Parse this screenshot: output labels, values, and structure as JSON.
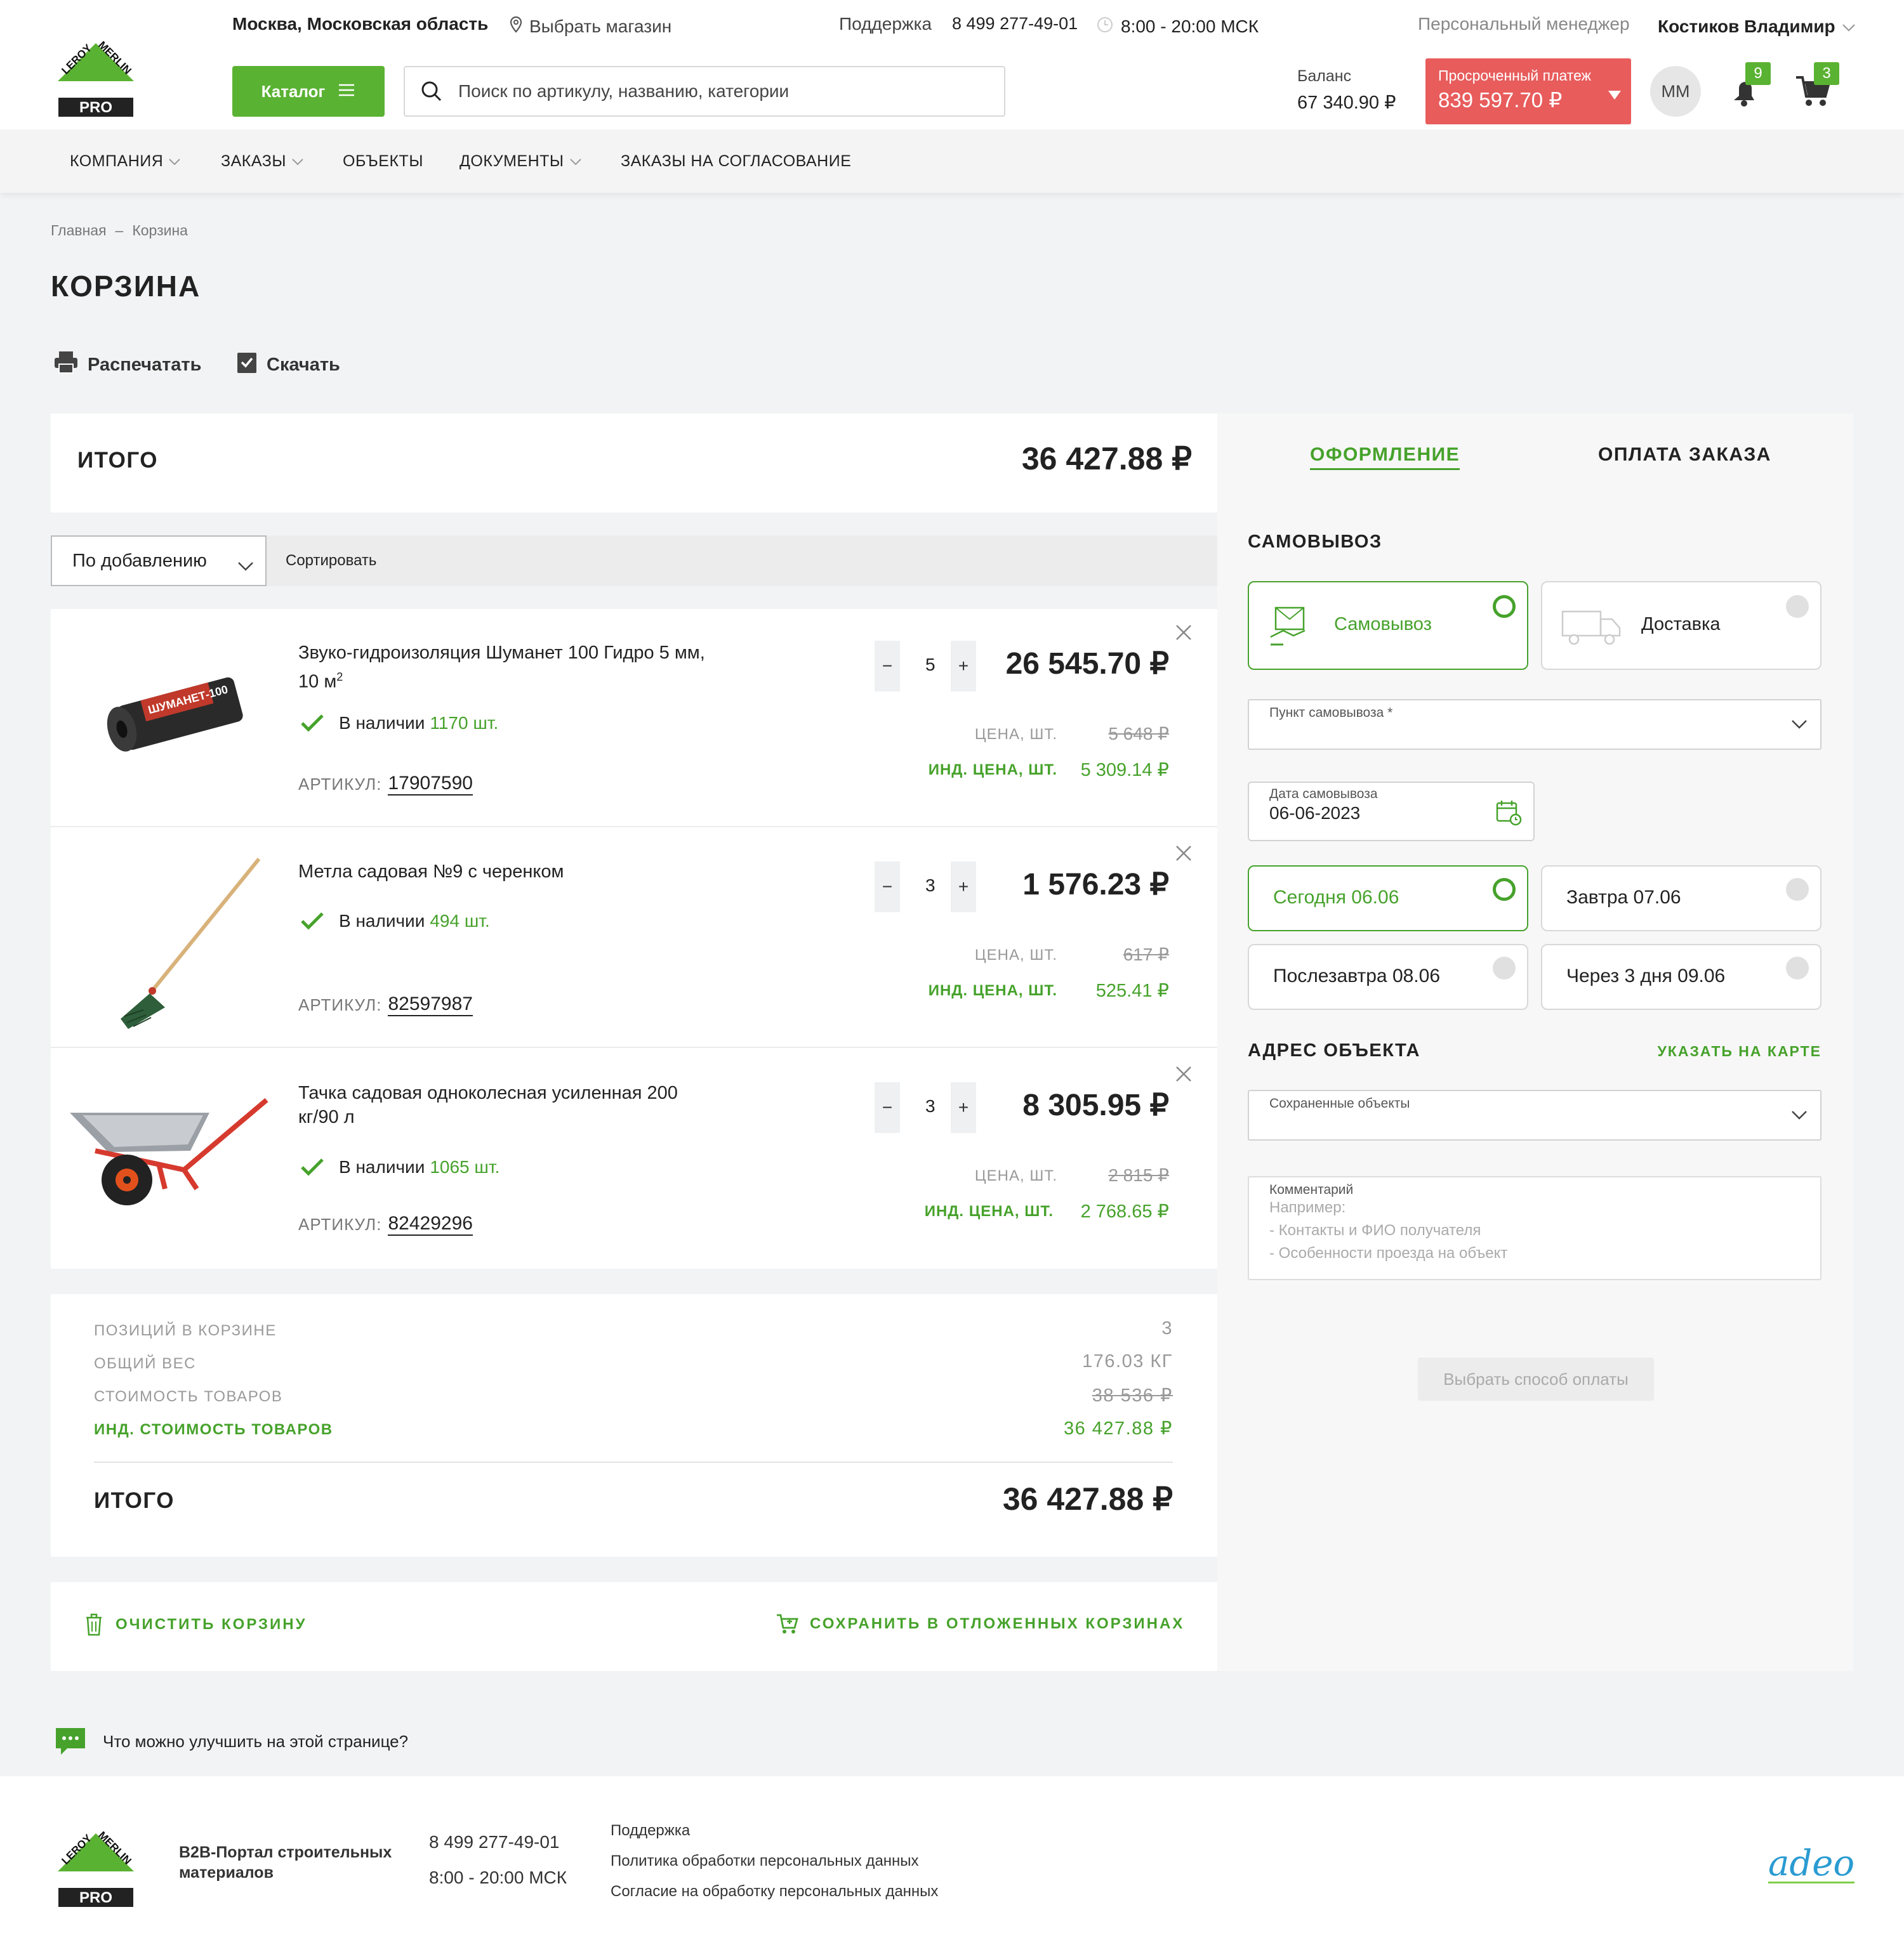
{
  "header": {
    "city": "Москва, Московская область",
    "choose_store": "Выбрать магазин",
    "support_label": "Поддержка",
    "support_phone": "8 499 277-49-01",
    "hours": "8:00 - 20:00 МСК",
    "manager_label": "Персональный менеджер",
    "manager_name": "Костиков Владимир",
    "catalog_label": "Каталог",
    "search_placeholder": "Поиск по артикулу, названию, категории",
    "balance_label": "Баланс",
    "balance_value": "67 340.90 ₽",
    "overdue_label": "Просроченный платеж",
    "overdue_value": "839 597.70 ₽",
    "avatar_initials": "ММ",
    "notifications_count": "9",
    "cart_count": "3",
    "logo_top": "LEROY MERLIN",
    "logo_pro": "PRO"
  },
  "nav": [
    "КОМПАНИЯ",
    "ЗАКАЗЫ",
    "ОБЪЕКТЫ",
    "ДОКУМЕНТЫ",
    "ЗАКАЗЫ НА СОГЛАСОВАНИЕ"
  ],
  "breadcrumb": {
    "home": "Главная",
    "sep": "–",
    "current": "Корзина"
  },
  "page_title": "КОРЗИНА",
  "actions": {
    "print": "Распечатать",
    "download": "Скачать"
  },
  "total_card": {
    "label": "ИТОГО",
    "value": "36 427.88 ₽"
  },
  "sort": {
    "selected": "По добавлению",
    "label": "Сортировать"
  },
  "items": [
    {
      "name_line1": "Звуко-гидроизоляция Шуманет 100 Гидро 5 мм,",
      "name_line2": "10 м",
      "sup": "2",
      "stock_label": "В наличии",
      "stock_qty": "1170 шт.",
      "article_label": "АРТИКУЛ:",
      "article": "17907590",
      "qty": "5",
      "sum": "26 545.70 ₽",
      "price_label": "ЦЕНА, ШТ.",
      "price": "5 648 ₽",
      "ind_label": "ИНД. ЦЕНА, ШТ.",
      "ind_price": "5 309.14 ₽",
      "image_text": "ШУМАНЕТ-100"
    },
    {
      "name_line1": "Метла садовая №9 с черенком",
      "name_line2": "",
      "sup": "",
      "stock_label": "В наличии",
      "stock_qty": "494 шт.",
      "article_label": "АРТИКУЛ:",
      "article": "82597987",
      "qty": "3",
      "sum": "1 576.23 ₽",
      "price_label": "ЦЕНА, ШТ.",
      "price": "617 ₽",
      "ind_label": "ИНД. ЦЕНА, ШТ.",
      "ind_price": "525.41 ₽"
    },
    {
      "name_line1": "Тачка садовая одноколесная усиленная 200",
      "name_line2": "кг/90 л",
      "sup": "",
      "stock_label": "В наличии",
      "stock_qty": "1065 шт.",
      "article_label": "АРТИКУЛ:",
      "article": "82429296",
      "qty": "3",
      "sum": "8 305.95 ₽",
      "price_label": "ЦЕНА, ШТ.",
      "price": "2 815 ₽",
      "ind_label": "ИНД. ЦЕНА, ШТ.",
      "ind_price": "2 768.65 ₽"
    }
  ],
  "summary": {
    "positions_label": "ПОЗИЦИЙ В КОРЗИНЕ",
    "positions_value": "3",
    "weight_label": "ОБЩИЙ ВЕС",
    "weight_value": "176.03 КГ",
    "cost_label": "СТОИМОСТЬ ТОВАРОВ",
    "cost_value": "38 536 ₽",
    "ind_cost_label": "ИНД. СТОИМОСТЬ ТОВАРОВ",
    "ind_cost_value": "36 427.88 ₽",
    "total_label": "ИТОГО",
    "total_value": "36 427.88 ₽"
  },
  "bottom_actions": {
    "clear": "ОЧИСТИТЬ КОРЗИНУ",
    "save": "СОХРАНИТЬ В ОТЛОЖЕННЫХ КОРЗИНАХ"
  },
  "checkout": {
    "tab_active": "ОФОРМЛЕНИЕ",
    "tab_other": "ОПЛАТА ЗАКАЗА",
    "pickup_title": "САМОВЫВОЗ",
    "opt_pickup": "Самовывоз",
    "opt_delivery": "Доставка",
    "pickup_point_label": "Пункт самовывоза *",
    "date_label": "Дата самовывоза",
    "date_value": "06-06-2023",
    "days": [
      "Сегодня 06.06",
      "Завтра 07.06",
      "Послезавтра 08.06",
      "Через 3 дня 09.06"
    ],
    "address_title": "АДРЕС ОБЪЕКТА",
    "map_link": "УКАЗАТЬ НА КАРТЕ",
    "saved_objects_label": "Сохраненные объекты",
    "comment_label": "Комментарий",
    "comment_hint_1": "Например:",
    "comment_hint_2": "- Контакты и ФИО получателя",
    "comment_hint_3": "- Особенности проезда на объект",
    "pay_button": "Выбрать способ оплаты"
  },
  "feedback": "Что можно улучшить на этой странице?",
  "footer": {
    "portal_line1": "B2B-Портал строительных",
    "portal_line2": "материалов",
    "phone": "8 499 277-49-01",
    "hours": "8:00 - 20:00 МСК",
    "links": [
      "Поддержка",
      "Политика обработки персональных данных",
      "Согласие на обработку персональных данных"
    ],
    "partner_logo": "adeo"
  },
  "colors": {
    "brand_green": "#5ab232",
    "text_green": "#46a22b",
    "overdue_red": "#e85c5c"
  }
}
